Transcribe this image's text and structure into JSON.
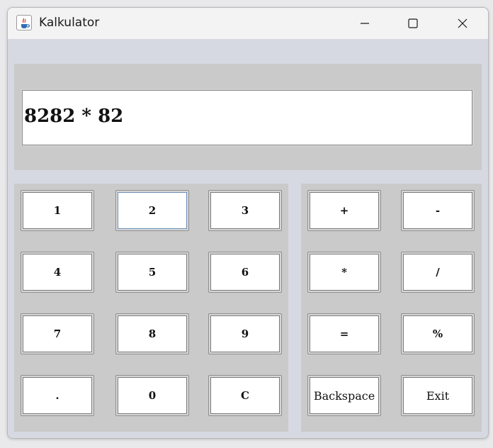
{
  "window": {
    "title": "Kalkulator",
    "icon": "java-cup-icon"
  },
  "title_controls": {
    "minimize_icon": "minimize-icon",
    "maximize_icon": "maximize-icon",
    "close_icon": "close-icon"
  },
  "display": {
    "value": "8282 * 82"
  },
  "number_keys": [
    "1",
    "2",
    "3",
    "4",
    "5",
    "6",
    "7",
    "8",
    "9",
    ".",
    "0",
    "C"
  ],
  "operator_keys": [
    "+",
    "-",
    "*",
    "/",
    "=",
    "%",
    "Backspace",
    "Exit"
  ],
  "focused_key": "2",
  "colors": {
    "panel": "#cacaca",
    "window_bg": "#d6d9e1",
    "titlebar": "#f3f3f3",
    "focus_border": "#6b8fb8"
  }
}
